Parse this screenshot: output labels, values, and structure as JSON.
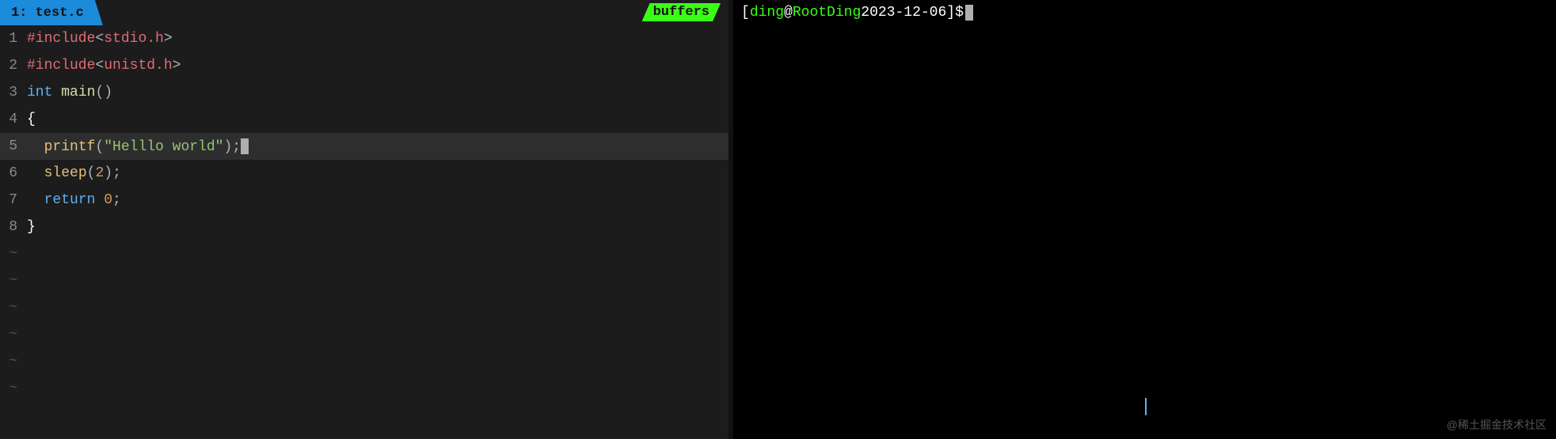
{
  "editor": {
    "tab_label": "1: test.c",
    "buffers_label": "buffers",
    "lines": [
      {
        "num": "1",
        "tokens": [
          {
            "type": "hash",
            "text": "#include"
          },
          {
            "type": "angle",
            "text": "<"
          },
          {
            "type": "lib",
            "text": "stdio.h"
          },
          {
            "type": "angle",
            "text": ">"
          }
        ]
      },
      {
        "num": "2",
        "tokens": [
          {
            "type": "hash",
            "text": "#include"
          },
          {
            "type": "angle",
            "text": "<"
          },
          {
            "type": "lib",
            "text": "unistd.h"
          },
          {
            "type": "angle",
            "text": ">"
          }
        ]
      },
      {
        "num": "3",
        "tokens": [
          {
            "type": "kw-int",
            "text": "int"
          },
          {
            "type": "punct",
            "text": " "
          },
          {
            "type": "kw-main",
            "text": "main"
          },
          {
            "type": "paren",
            "text": "()"
          }
        ]
      },
      {
        "num": "4",
        "tokens": [
          {
            "type": "brace",
            "text": "{"
          }
        ]
      },
      {
        "num": "5",
        "tokens": [
          {
            "type": "indent",
            "text": "    "
          },
          {
            "type": "kw-printf",
            "text": "printf"
          },
          {
            "type": "paren",
            "text": "("
          },
          {
            "type": "kw-string",
            "text": "\"Helllo world\""
          },
          {
            "type": "paren",
            "text": ")"
          },
          {
            "type": "semi",
            "text": ";"
          }
        ],
        "highlighted": true
      },
      {
        "num": "6",
        "tokens": [
          {
            "type": "indent",
            "text": "    "
          },
          {
            "type": "kw-sleep",
            "text": "sleep"
          },
          {
            "type": "paren",
            "text": "("
          },
          {
            "type": "kw-zero",
            "text": "2"
          },
          {
            "type": "paren",
            "text": ")"
          },
          {
            "type": "semi",
            "text": ";"
          }
        ]
      },
      {
        "num": "7",
        "tokens": [
          {
            "type": "indent",
            "text": "    "
          },
          {
            "type": "kw-return",
            "text": "return"
          },
          {
            "type": "punct",
            "text": " "
          },
          {
            "type": "kw-zero",
            "text": "0"
          },
          {
            "type": "semi",
            "text": ";"
          }
        ]
      },
      {
        "num": "8",
        "tokens": [
          {
            "type": "brace",
            "text": "}"
          }
        ]
      }
    ],
    "tilde_count": 6
  },
  "terminal": {
    "prompt_open": "[",
    "user": "ding",
    "at": "@",
    "host": "RootDing",
    "space": " ",
    "date": "2023-12-06",
    "close": "]$",
    "watermark": "@稀土掘金技术社区"
  }
}
